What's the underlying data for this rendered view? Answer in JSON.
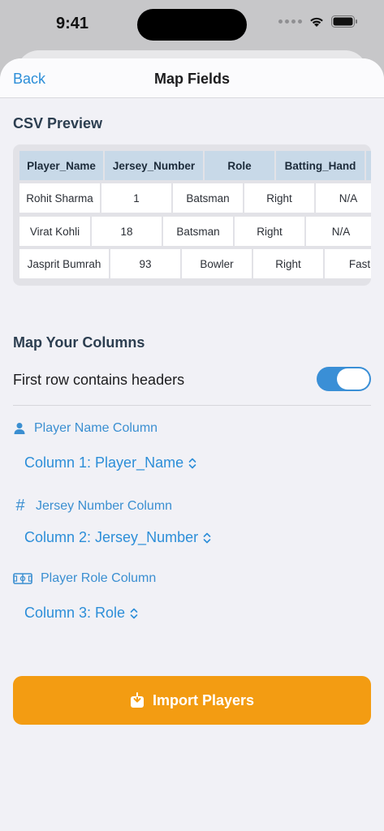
{
  "status": {
    "time": "9:41"
  },
  "nav": {
    "back_label": "Back",
    "title": "Map Fields"
  },
  "preview": {
    "title": "CSV Preview",
    "headers": [
      "Player_Name",
      "Jersey_Number",
      "Role",
      "Batting_Hand"
    ],
    "rows": [
      [
        "Rohit Sharma",
        "1",
        "Batsman",
        "Right",
        "N/A"
      ],
      [
        "Virat Kohli",
        "18",
        "Batsman",
        "Right",
        "N/A"
      ],
      [
        "Jasprit Bumrah",
        "93",
        "Bowler",
        "Right",
        "Fast"
      ]
    ]
  },
  "mapping": {
    "title": "Map Your Columns",
    "header_toggle_label": "First row contains headers",
    "header_toggle_on": true,
    "fields": [
      {
        "label": "Player Name Column",
        "icon": "person-icon",
        "value": "Column 1: Player_Name"
      },
      {
        "label": "Jersey Number Column",
        "icon": "number-sign-icon",
        "value": "Column 2: Jersey_Number"
      },
      {
        "label": "Player Role Column",
        "icon": "field-icon",
        "value": "Column 3: Role"
      }
    ]
  },
  "import_button": {
    "label": "Import Players",
    "icon": "import-icon"
  },
  "colors": {
    "accent": "#2c8ed8",
    "import": "#f39c12",
    "table_header": "#c8d9e8",
    "toggle_on": "#3a8fd6"
  }
}
